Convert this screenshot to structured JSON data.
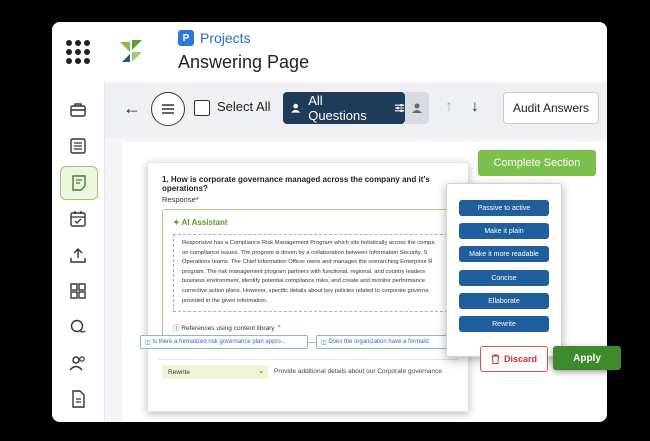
{
  "header": {
    "breadcrumb": "Projects",
    "breadcrumb_icon": "P",
    "title": "Answering Page"
  },
  "toolbar": {
    "select_all": "Select All",
    "filter_label": "All Questions",
    "audit_label": "Audit Answers"
  },
  "section": {
    "complete_label": "Complete Section"
  },
  "question": {
    "text": "1. How is corporate governance managed across the company and it’s operations?",
    "response_label": "Response*"
  },
  "ai": {
    "title": "AI Assistant",
    "answer_lines": [
      "Responsive has a Compliance Risk Management Program which sits holistically across the compa",
      "on compliance issues. The program is driven by a collaboration between Information Security, S",
      "Operations teams. The Chief Information Officer owns and manages the overarching Enterprise R",
      "program. The risk management program partners with functional, regional, and country leaders",
      "business environment, identify potential compliance risks, and create and monitor performance",
      "corrective action plans. However, specific details about key policies related to corporate governa",
      "provided in the given information."
    ],
    "references_label": "References using content library",
    "chips": [
      "Is there a formalized risk governance plan appro...",
      "Does the organization have a formaliz"
    ],
    "mode_value": "Rewrite",
    "prompt_text": "Provide additional details about our Corporate governance"
  },
  "actions": [
    "Passive to active",
    "Make it plain",
    "Make it more readable",
    "Concise",
    "Ellaborate",
    "Rewrite"
  ],
  "buttons": {
    "discard": "Discard",
    "apply": "Apply"
  },
  "colors": {
    "brand_green": "#7dbf4c",
    "navy": "#1f3b5a",
    "action_blue": "#1f5f9e",
    "discard_red": "#c9302c",
    "apply_green": "#3f8a2c"
  }
}
